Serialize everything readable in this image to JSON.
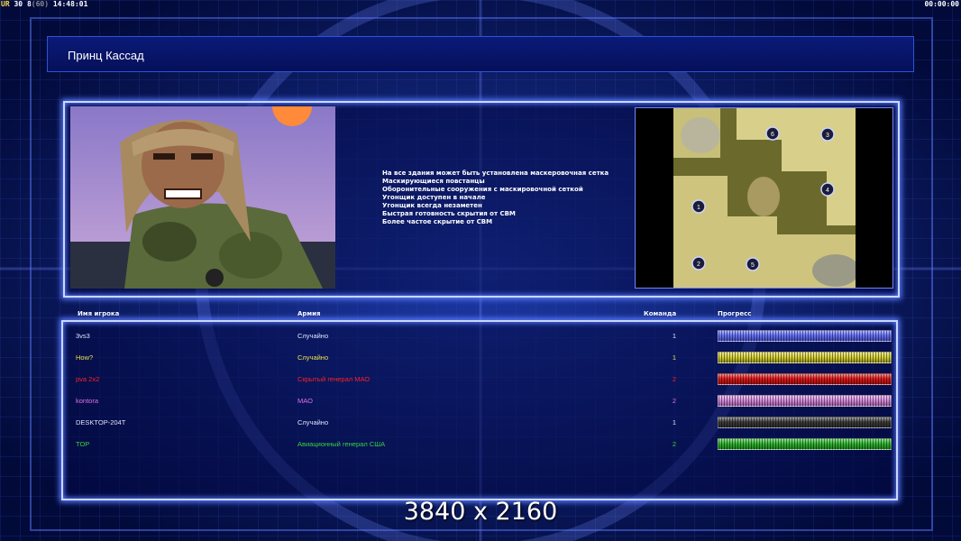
{
  "hud": {
    "fps_prefix": "UR",
    "fps_value": "30",
    "fps_mid": "8",
    "fps_limit": "(60)",
    "clock": "14:48:01",
    "game_timer": "00:00:00"
  },
  "title": "Принц Кассад",
  "portrait_icon": "general-portrait",
  "features": [
    "На все здания может быть установлена маскеровочная сетка",
    "Маскирующиеся повстанцы",
    "Оборонительные сооружения с маскировочной сеткой",
    "Угонщик доступен в начале",
    "Угонщик всегда незаметен",
    "Быстрая готовность скрытия от СВМ",
    "Более частое скрытие от СВМ"
  ],
  "map": {
    "markers": [
      "1",
      "2",
      "3",
      "4",
      "5",
      "6"
    ]
  },
  "table": {
    "headers": {
      "player": "Имя игрока",
      "army": "Армия",
      "team": "Команда",
      "progress": "Прогресс"
    },
    "rows": [
      {
        "name": "3vs3",
        "army": "Случайно",
        "team": "1",
        "color": "#dfe3ff",
        "bar": "#6470ff",
        "progress": 1
      },
      {
        "name": "How?",
        "army": "Случайно",
        "team": "1",
        "color": "#e8e04a",
        "bar": "#d8d233",
        "progress": 1
      },
      {
        "name": "pva 2x2",
        "army": "Скрытый генерал МАО",
        "team": "2",
        "color": "#ff2020",
        "bar": "#e01818",
        "progress": 1
      },
      {
        "name": "kontora",
        "army": "МАО",
        "team": "2",
        "color": "#e070e8",
        "bar": "#d88ae0",
        "progress": 1
      },
      {
        "name": "DESKTOP-204T",
        "army": "Случайно",
        "team": "1",
        "color": "#dfe3ff",
        "bar": "#3a3a3a",
        "progress": 1
      },
      {
        "name": "TOP",
        "army": "Авиационный генерал США",
        "team": "2",
        "color": "#3ad23a",
        "bar": "#2fb82f",
        "progress": 1
      }
    ]
  },
  "watermark": "3840 x 2160"
}
